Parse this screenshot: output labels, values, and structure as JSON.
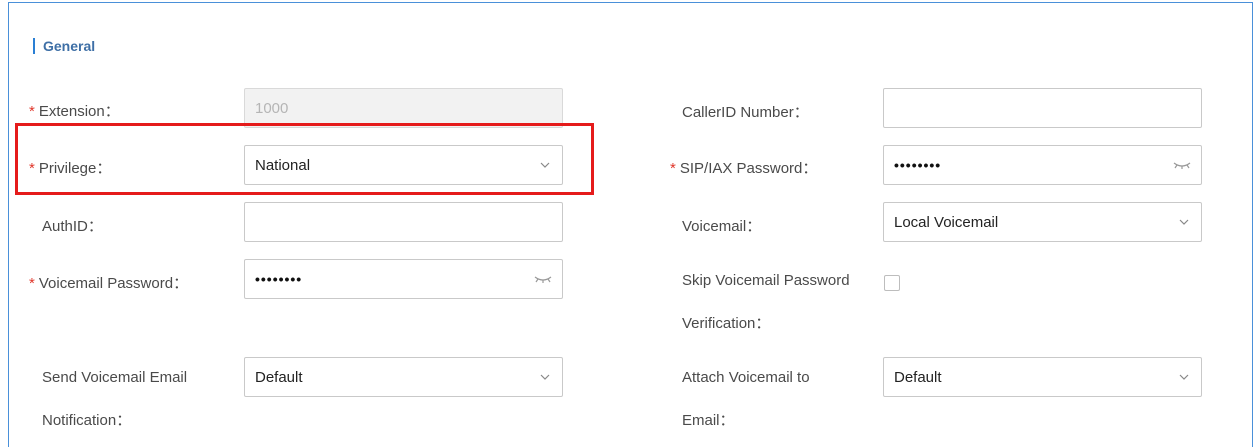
{
  "section": {
    "title": "General"
  },
  "colors": {
    "required": "#e0362a",
    "highlight": "#e51b1b",
    "accent": "#2a7fd4"
  },
  "left": {
    "extension": {
      "required": true,
      "label": "Extension：",
      "value": "1000",
      "disabled": true
    },
    "privilege": {
      "required": true,
      "label": "Privilege：",
      "value": "National",
      "icon": "chevron-down-icon"
    },
    "authid": {
      "required": false,
      "label": "AuthID：",
      "value": ""
    },
    "voicemail_password": {
      "required": true,
      "label": "Voicemail Password：",
      "value": "••••••••",
      "icon": "eye-closed-icon"
    },
    "send_voicemail_email": {
      "required": false,
      "label_line1": "Send Voicemail Email",
      "label_line2": "Notification：",
      "value": "Default",
      "icon": "chevron-down-icon"
    }
  },
  "right": {
    "callerid_number": {
      "required": false,
      "label": "CallerID Number：",
      "value": ""
    },
    "sip_iax_password": {
      "required": true,
      "label": "SIP/IAX Password：",
      "value": "••••••••",
      "icon": "eye-closed-icon"
    },
    "voicemail": {
      "required": false,
      "label": "Voicemail：",
      "value": "Local Voicemail",
      "icon": "chevron-down-icon"
    },
    "skip_voicemail_password": {
      "label_line1": "Skip Voicemail Password",
      "label_line2": "Verification：",
      "checked": false
    },
    "attach_voicemail": {
      "label_line1": "Attach Voicemail to",
      "label_line2": "Email：",
      "value": "Default",
      "icon": "chevron-down-icon"
    }
  },
  "markers": {
    "required": "*"
  }
}
